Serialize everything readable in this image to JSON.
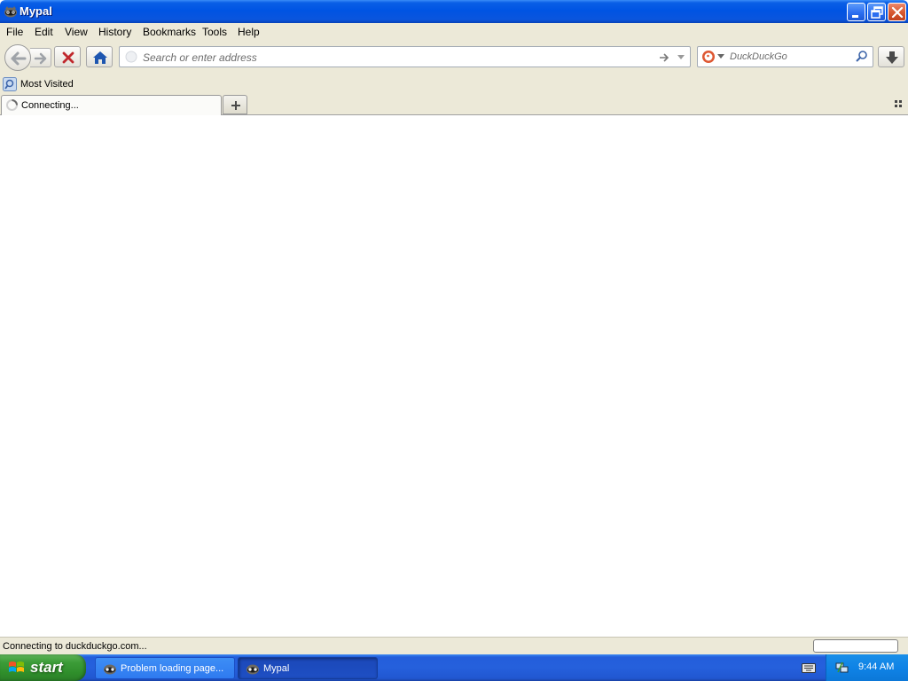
{
  "window": {
    "title": "Mypal"
  },
  "menubar": {
    "items": [
      {
        "label": "File"
      },
      {
        "label": "Edit"
      },
      {
        "label": "View"
      },
      {
        "label": "History"
      },
      {
        "label": "Bookmarks"
      },
      {
        "label": "Tools"
      },
      {
        "label": "Help"
      }
    ]
  },
  "navbar": {
    "url_placeholder": "Search or enter address",
    "search_placeholder": "DuckDuckGo"
  },
  "bookmarks": {
    "items": [
      {
        "label": "Most Visited"
      }
    ]
  },
  "tabs": [
    {
      "label": "Connecting..."
    }
  ],
  "statusbar": {
    "text": "Connecting to duckduckgo.com..."
  },
  "taskbar": {
    "start_label": "start",
    "buttons": [
      {
        "label": "Problem loading page..."
      },
      {
        "label": "Mypal"
      }
    ],
    "clock": "9:44 AM"
  },
  "colors": {
    "titlebar": "#0054e3",
    "chrome": "#ece9d8",
    "start": "#3c9c38",
    "taskbar": "#245edb",
    "stop_red": "#c0282d",
    "home_blue": "#1e56b0"
  },
  "icons": {
    "app": "raccoon-mask-icon",
    "back": "back-arrow-icon",
    "forward": "forward-arrow-icon",
    "stop": "stop-x-icon",
    "home": "home-icon",
    "go": "go-arrow-icon",
    "history": "dropdown-triangle-icon",
    "search_engine": "duckduckgo-icon",
    "search": "magnifier-icon",
    "download": "download-arrow-icon",
    "tab_throbber": "loading-spinner-icon",
    "new_tab": "plus-icon",
    "tab_list": "grid-icon"
  }
}
